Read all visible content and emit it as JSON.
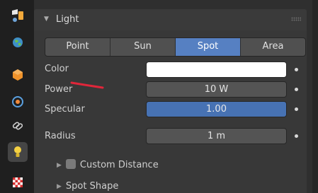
{
  "tabs": {
    "icons": [
      "render-icon",
      "world-icon",
      "object-icon",
      "physics-icon",
      "constraints-icon",
      "light-data-icon",
      "texture-icon"
    ],
    "active": "light-data-icon"
  },
  "panel": {
    "title": "Light",
    "light_types": [
      "Point",
      "Sun",
      "Spot",
      "Area"
    ],
    "selected_type": "Spot",
    "color": {
      "label": "Color",
      "value": "#ffffff"
    },
    "power": {
      "label": "Power",
      "value": "10 W"
    },
    "specular": {
      "label": "Specular",
      "value": "1.00"
    },
    "radius": {
      "label": "Radius",
      "value": "1 m"
    },
    "custom_distance": {
      "label": "Custom Distance",
      "checked": false
    },
    "spot_shape": {
      "label": "Spot Shape"
    }
  },
  "colors": {
    "accent": "#5680c2",
    "annotation": "#e0263a"
  }
}
